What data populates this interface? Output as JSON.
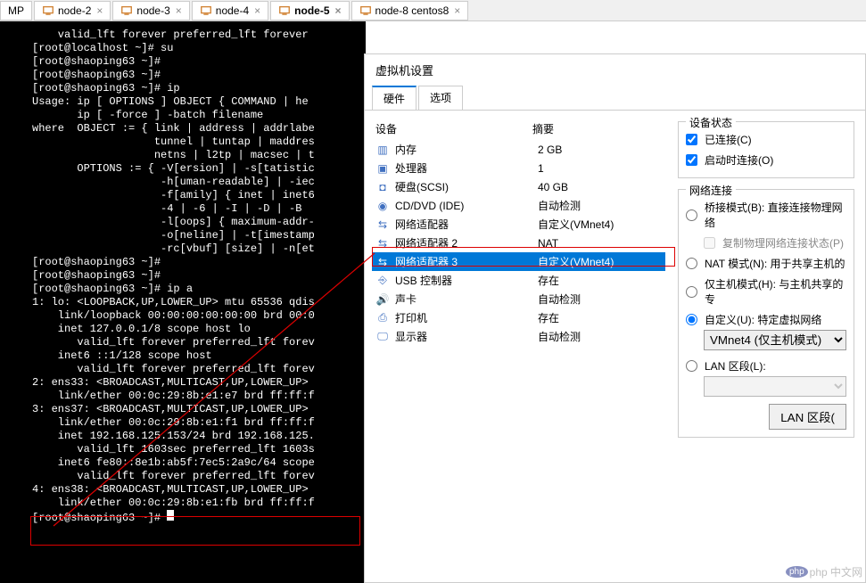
{
  "tabs": [
    {
      "label": "MP",
      "closable": false
    },
    {
      "label": "node-2",
      "closable": true
    },
    {
      "label": "node-3",
      "closable": true
    },
    {
      "label": "node-4",
      "closable": true
    },
    {
      "label": "node-5",
      "closable": true,
      "active": true
    },
    {
      "label": "node-8 centos8",
      "closable": true
    }
  ],
  "terminal_lines": [
    "    valid_lft forever preferred_lft forever",
    "[root@localhost ~]# su",
    "[root@shaoping63 ~]#",
    "[root@shaoping63 ~]#",
    "[root@shaoping63 ~]# ip",
    "Usage: ip [ OPTIONS ] OBJECT { COMMAND | he",
    "       ip [ -force ] -batch filename",
    "where  OBJECT := { link | address | addrlabe",
    "                   tunnel | tuntap | maddres",
    "                   netns | l2tp | macsec | t",
    "       OPTIONS := { -V[ersion] | -s[tatistic",
    "                    -h[uman-readable] | -iec",
    "                    -f[amily] { inet | inet6",
    "                    -4 | -6 | -I | -D | -B  ",
    "                    -l[oops] { maximum-addr-",
    "                    -o[neline] | -t[imestamp",
    "                    -rc[vbuf] [size] | -n[et",
    "[root@shaoping63 ~]#",
    "[root@shaoping63 ~]#",
    "[root@shaoping63 ~]# ip a",
    "1: lo: <LOOPBACK,UP,LOWER_UP> mtu 65536 qdis",
    "    link/loopback 00:00:00:00:00:00 brd 00:0",
    "    inet 127.0.0.1/8 scope host lo",
    "       valid_lft forever preferred_lft forev",
    "    inet6 ::1/128 scope host",
    "       valid_lft forever preferred_lft forev",
    "2: ens33: <BROADCAST,MULTICAST,UP,LOWER_UP>",
    "    link/ether 00:0c:29:8b:e1:e7 brd ff:ff:f",
    "3: ens37: <BROADCAST,MULTICAST,UP,LOWER_UP>",
    "    link/ether 00:0c:29:8b:e1:f1 brd ff:ff:f",
    "    inet 192.168.125.153/24 brd 192.168.125.",
    "       valid_lft 1603sec preferred_lft 1603s",
    "    inet6 fe80::8e1b:ab5f:7ec5:2a9c/64 scope",
    "       valid_lft forever preferred_lft forev",
    "4: ens38: <BROADCAST,MULTICAST,UP,LOWER_UP>",
    "    link/ether 00:0c:29:8b:e1:fb brd ff:ff:f",
    "[root@shaoping63 ~]# "
  ],
  "settings": {
    "title": "虚拟机设置",
    "tab_hardware": "硬件",
    "tab_options": "选项",
    "col_device": "设备",
    "col_summary": "摘要",
    "devices": [
      {
        "icon": "memory",
        "name": "内存",
        "summary": "2 GB"
      },
      {
        "icon": "cpu",
        "name": "处理器",
        "summary": "1"
      },
      {
        "icon": "disk",
        "name": "硬盘(SCSI)",
        "summary": "40 GB"
      },
      {
        "icon": "cd",
        "name": "CD/DVD (IDE)",
        "summary": "自动检测"
      },
      {
        "icon": "net",
        "name": "网络适配器",
        "summary": "自定义(VMnet4)"
      },
      {
        "icon": "net",
        "name": "网络适配器 2",
        "summary": "NAT"
      },
      {
        "icon": "net",
        "name": "网络适配器 3",
        "summary": "自定义(VMnet4)",
        "selected": true
      },
      {
        "icon": "usb",
        "name": "USB 控制器",
        "summary": "存在"
      },
      {
        "icon": "sound",
        "name": "声卡",
        "summary": "自动检测"
      },
      {
        "icon": "printer",
        "name": "打印机",
        "summary": "存在"
      },
      {
        "icon": "display",
        "name": "显示器",
        "summary": "自动检测"
      }
    ],
    "status": {
      "group": "设备状态",
      "connected": "已连接(C)",
      "connect_at_power": "启动时连接(O)"
    },
    "network": {
      "group": "网络连接",
      "bridge": "桥接模式(B): 直接连接物理网络",
      "replicate": "复制物理网络连接状态(P)",
      "nat": "NAT 模式(N): 用于共享主机的",
      "hostonly": "仅主机模式(H): 与主机共享的专",
      "custom": "自定义(U): 特定虚拟网络",
      "custom_value": "VMnet4 (仅主机模式)",
      "lan": "LAN 区段(L):",
      "lan_button": "LAN 区段("
    }
  },
  "watermark": "php 中文网"
}
